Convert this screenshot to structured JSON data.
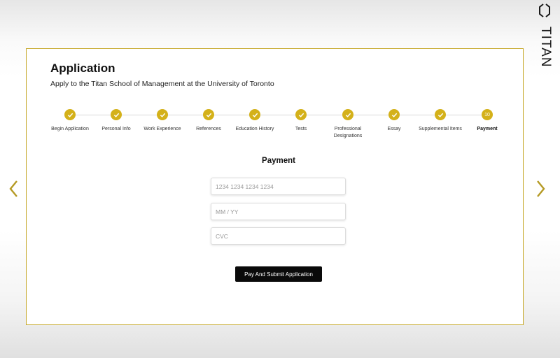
{
  "brand": {
    "name": "TITAN"
  },
  "application": {
    "title": "Application",
    "subtitle": "Apply to the Titan School of Management at the University of Toronto"
  },
  "steps": [
    {
      "label": "Begin Application",
      "status": "complete"
    },
    {
      "label": "Personal Info",
      "status": "complete"
    },
    {
      "label": "Work Experience",
      "status": "complete"
    },
    {
      "label": "References",
      "status": "complete"
    },
    {
      "label": "Education History",
      "status": "complete"
    },
    {
      "label": "Tests",
      "status": "complete"
    },
    {
      "label": "Professional Designations",
      "status": "complete"
    },
    {
      "label": "Essay",
      "status": "complete"
    },
    {
      "label": "Supplemental Items",
      "status": "complete"
    },
    {
      "label": "Payment",
      "status": "current",
      "number": "10"
    }
  ],
  "payment": {
    "title": "Payment",
    "card_number_placeholder": "1234 1234 1234 1234",
    "expiry_placeholder": "MM / YY",
    "cvc_placeholder": "CVC",
    "submit_label": "Pay And Submit Application"
  },
  "colors": {
    "accent": "#d4b11a",
    "frame_border": "#c6a828",
    "button_bg": "#0a0a0a"
  },
  "icons": {
    "step_complete": "checkmark-icon",
    "nav_previous": "chevron-left-icon",
    "nav_next": "chevron-right-icon",
    "brand_logo": "hexagon-logo-icon"
  }
}
